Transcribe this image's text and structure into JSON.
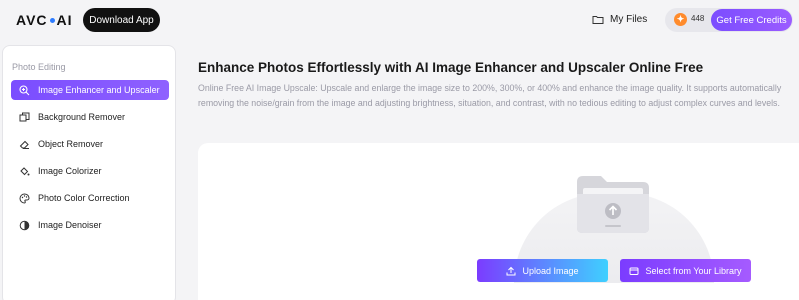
{
  "header": {
    "logo_text_left": "AVC",
    "logo_text_right": "AI",
    "download_label": "Download App",
    "my_files_label": "My Files",
    "credits_count": "448",
    "get_credits_label": "Get Free Credits"
  },
  "sidebar": {
    "heading": "Photo Editing",
    "items": [
      {
        "label": "Image Enhancer and Upscaler",
        "icon": "zoom-in-icon",
        "active": true
      },
      {
        "label": "Background Remover",
        "icon": "copy-layers-icon",
        "active": false
      },
      {
        "label": "Object Remover",
        "icon": "eraser-icon",
        "active": false
      },
      {
        "label": "Image Colorizer",
        "icon": "paint-bucket-icon",
        "active": false
      },
      {
        "label": "Photo Color Correction",
        "icon": "palette-icon",
        "active": false
      },
      {
        "label": "Image Denoiser",
        "icon": "half-circle-icon",
        "active": false
      }
    ]
  },
  "main": {
    "title": "Enhance Photos Effortlessly with AI Image Enhancer and Upscaler Online Free",
    "description": "Online Free AI Image Upscale: Upscale and enlarge the image size to 200%, 300%, or 400% and enhance the image quality. It supports automatically removing the noise/grain from the image and adjusting brightness, situation, and contrast, with no tedious editing to adjust complex curves and levels.",
    "upload_label": "Upload Image",
    "library_label": "Select from Your Library"
  },
  "colors": {
    "accent": "#7b4dff",
    "credit_coin": "#ff8b2c",
    "upload_gradient_end": "#3fd0ff"
  }
}
